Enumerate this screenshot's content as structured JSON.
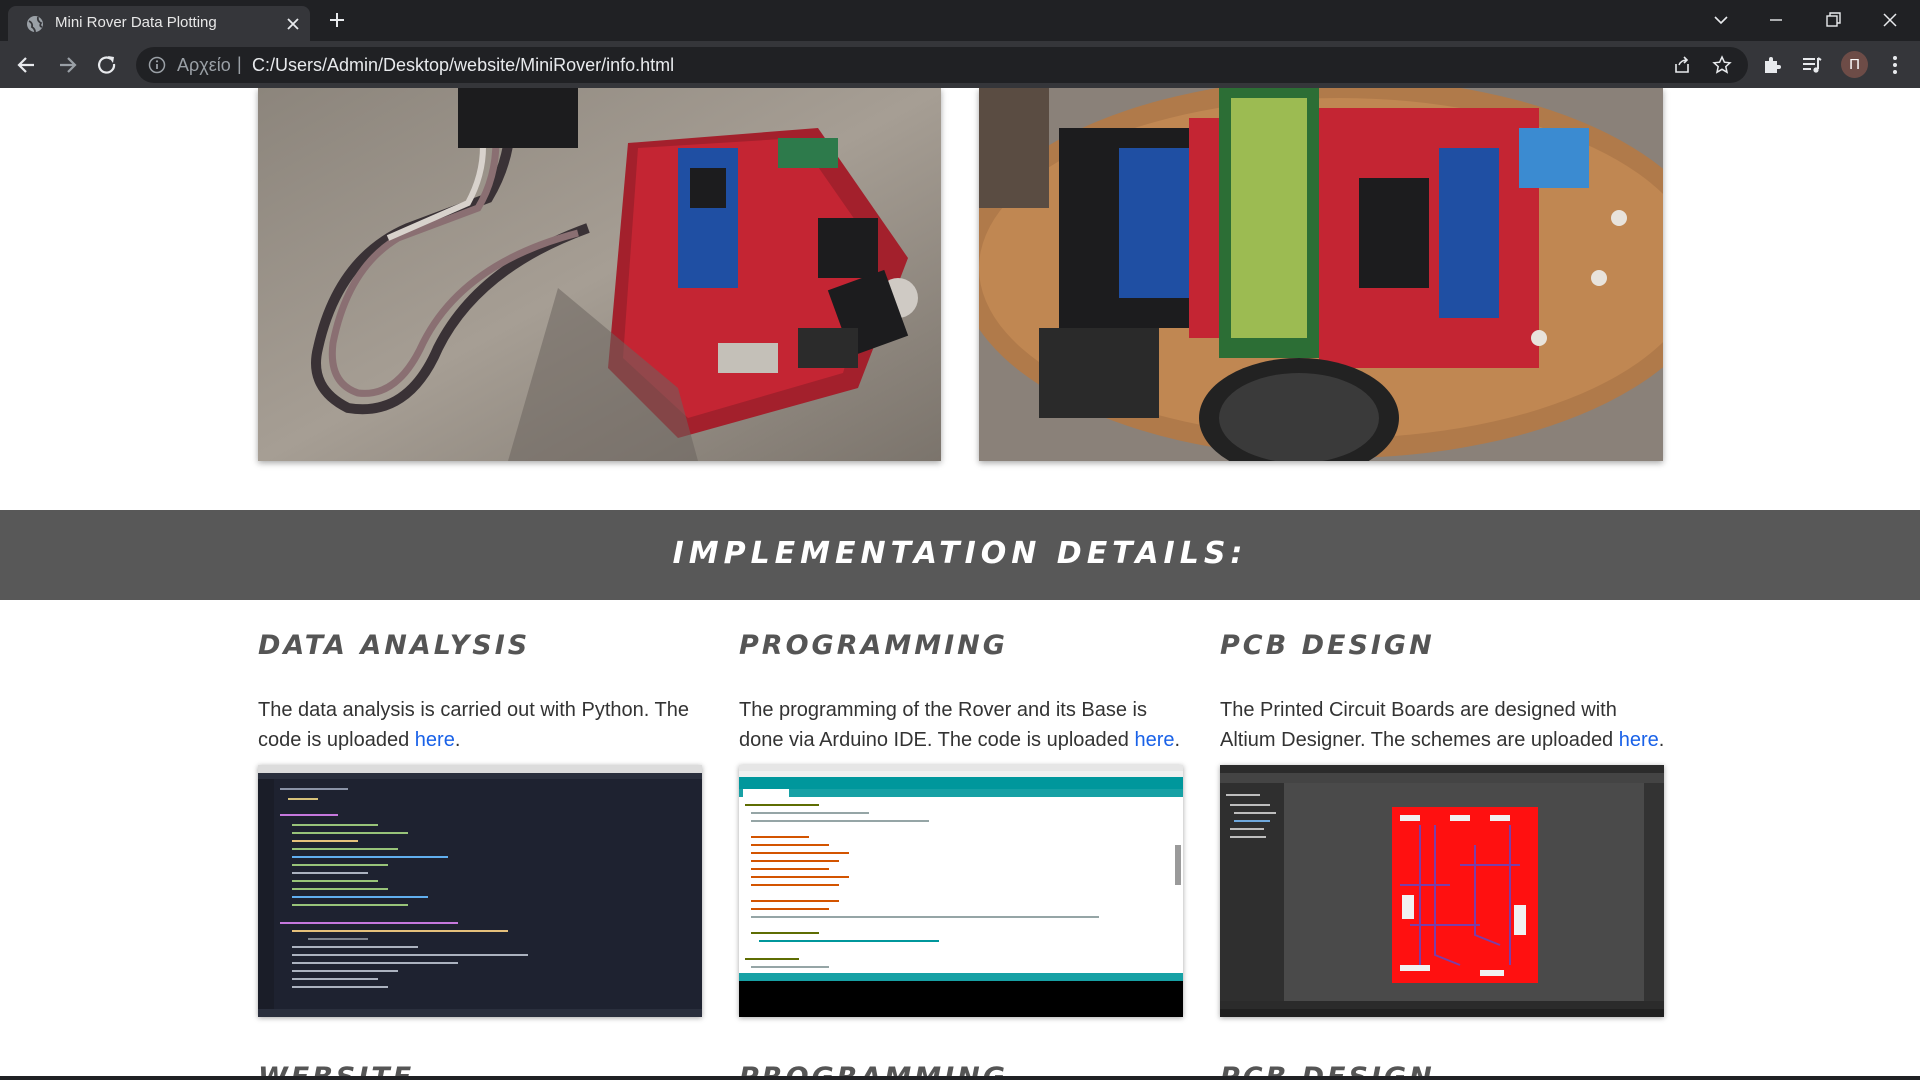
{
  "browser": {
    "tab_title": "Mini Rover Data Plotting",
    "url_prefix": "Αρχείο",
    "url_separator": "|",
    "url": "C:/Users/Admin/Desktop/website/MiniRover/info.html",
    "profile_initial": "Π",
    "icons": [
      "globe-icon",
      "close-icon",
      "plus-icon",
      "chevron-down-icon",
      "minimize-icon",
      "restore-icon",
      "close-window-icon",
      "back-arrow-icon",
      "forward-arrow-icon",
      "reload-icon",
      "info-icon",
      "share-icon",
      "star-icon",
      "puzzle-icon",
      "media-queue-icon",
      "kebab-menu-icon"
    ]
  },
  "page": {
    "section_title": "IMPLEMENTATION DETAILS:",
    "columns": [
      {
        "title": "DATA ANALYSIS",
        "text_before_link": "The data analysis is carried out with Python. The code is uploaded ",
        "link": "here",
        "text_after_link": "."
      },
      {
        "title": "PROGRAMMING",
        "text_before_link": "The programming of the Rover and its Base is done via Arduino IDE. The code is uploaded ",
        "link": "here",
        "text_after_link": "."
      },
      {
        "title": "PCB DESIGN",
        "text_before_link": "The Printed Circuit Boards are designed with Altium Designer. The schemes are uploaded ",
        "link": "here",
        "text_after_link": "."
      }
    ],
    "next_row_titles": [
      "WEBSITE",
      "PROGRAMMING",
      "PCB DESIGN"
    ],
    "colors": {
      "banner": "#585858",
      "heading": "#555555",
      "link": "#1a62e8",
      "body_text": "#333333"
    }
  }
}
